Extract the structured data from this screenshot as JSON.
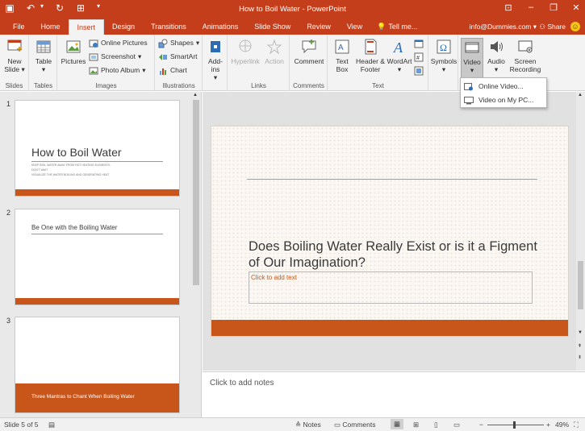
{
  "window": {
    "title": "How to Boil Water - PowerPoint"
  },
  "qat": {
    "save_icon": "save-icon",
    "undo_icon": "undo-icon",
    "redo_icon": "redo-icon",
    "present_icon": "start-from-beginning-icon"
  },
  "tabs": [
    {
      "label": "File"
    },
    {
      "label": "Home"
    },
    {
      "label": "Insert"
    },
    {
      "label": "Design"
    },
    {
      "label": "Transitions"
    },
    {
      "label": "Animations"
    },
    {
      "label": "Slide Show"
    },
    {
      "label": "Review"
    },
    {
      "label": "View"
    }
  ],
  "tellme": {
    "label": "Tell me..."
  },
  "account": {
    "email": "info@Dummies.com"
  },
  "share": {
    "label": "Share"
  },
  "ribbon": {
    "slides": {
      "new_slide": "New Slide",
      "group": "Slides"
    },
    "tables": {
      "table": "Table",
      "group": "Tables"
    },
    "images": {
      "pictures": "Pictures",
      "online_pictures": "Online Pictures",
      "screenshot": "Screenshot",
      "photo_album": "Photo Album",
      "group": "Images"
    },
    "illustrations": {
      "shapes": "Shapes",
      "smartart": "SmartArt",
      "chart": "Chart",
      "group": "Illustrations"
    },
    "addins": {
      "label": "Add-ins"
    },
    "links": {
      "hyperlink": "Hyperlink",
      "action": "Action",
      "group": "Links"
    },
    "comments": {
      "comment": "Comment",
      "group": "Comments"
    },
    "text": {
      "text_box": "Text Box",
      "header_footer": "Header & Footer",
      "wordart": "WordArt",
      "group": "Text"
    },
    "symbols": {
      "label": "Symbols"
    },
    "media": {
      "video": "Video",
      "audio": "Audio",
      "screen_recording": "Screen Recording"
    }
  },
  "video_menu": {
    "items": [
      {
        "label": "Online Video..."
      },
      {
        "label": "Video on My PC..."
      }
    ]
  },
  "thumbnails": [
    {
      "number": "1",
      "title": "How to Boil Water",
      "subtitle_1": "KEEP BOIL WATER AWAY FROM HOT HEATING ELEMENTS",
      "subtitle_2": "DON'T WAIT",
      "subtitle_3": "VISUALIZE THE WATER BOILING AND GENERATING HEAT"
    },
    {
      "number": "2",
      "title": "Be One with the Boiling Water"
    },
    {
      "number": "3",
      "title": "Three Mantras to Chant When Boiling Water"
    }
  ],
  "slide": {
    "title": "Does Boiling Water Really Exist or is it a Figment of Our Imagination?",
    "subtitle_placeholder": "Click to add text"
  },
  "notes": {
    "placeholder": "Click to add notes"
  },
  "status": {
    "slide_info": "Slide 5 of 5",
    "notes": "Notes",
    "comments": "Comments",
    "zoom": "49%",
    "zoom_minus": "−",
    "zoom_plus": "+"
  },
  "colors": {
    "accent": "#c43e1c",
    "slide_bar": "#c8561b"
  }
}
